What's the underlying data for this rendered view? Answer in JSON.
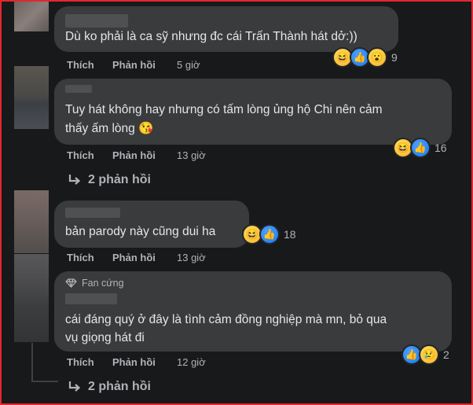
{
  "comments": [
    {
      "text_lines": [
        "Dù ko phải là ca sỹ nhưng đc cái Trấn Thành hát dở:))"
      ],
      "actions": {
        "like": "Thích",
        "reply": "Phản hồi"
      },
      "time": "5 giờ",
      "reactions": {
        "icons": [
          "haha-icon",
          "like-icon",
          "wow-icon"
        ],
        "count": "9"
      }
    },
    {
      "text_lines": [
        "Tuy hát không hay nhưng có tấm lòng ủng hộ Chi nên cảm",
        "thấy ấm lòng 😘"
      ],
      "actions": {
        "like": "Thích",
        "reply": "Phản hồi"
      },
      "time": "13 giờ",
      "reactions": {
        "icons": [
          "haha-icon",
          "like-icon"
        ],
        "count": "16"
      },
      "replies_label": "2 phản hồi"
    },
    {
      "text_lines": [
        "bản parody này cũng dui ha"
      ],
      "actions": {
        "like": "Thích",
        "reply": "Phản hồi"
      },
      "time": "13 giờ",
      "reactions": {
        "icons": [
          "haha-icon",
          "like-icon"
        ],
        "count": "18"
      }
    },
    {
      "badge": "Fan cứng",
      "text_lines": [
        "cái đáng quý ở đây là tình cảm đồng nghiệp mà mn, bỏ qua",
        "vụ giọng hát đi"
      ],
      "actions": {
        "like": "Thích",
        "reply": "Phản hồi"
      },
      "time": "12 giờ",
      "reactions": {
        "icons": [
          "like-icon",
          "sad-icon"
        ],
        "count": "2"
      },
      "replies_label": "2 phản hồi"
    }
  ],
  "colors": {
    "border": "#e4262e",
    "background": "#18191a",
    "bubble": "#3a3b3c",
    "text": "#e4e6eb",
    "muted": "#b0b3b8"
  }
}
